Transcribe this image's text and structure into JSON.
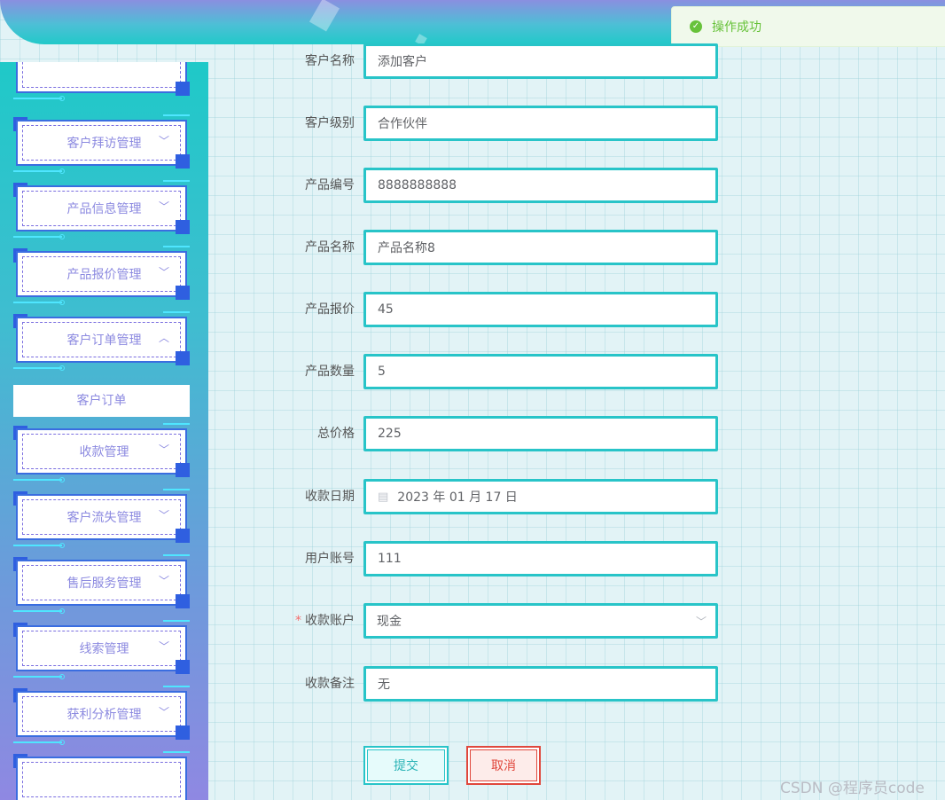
{
  "toast": {
    "message": "操作成功"
  },
  "sidebar": {
    "items": [
      {
        "label": "客户拜访管理",
        "expanded": false
      },
      {
        "label": "产品信息管理",
        "expanded": false
      },
      {
        "label": "产品报价管理",
        "expanded": false
      },
      {
        "label": "客户订单管理",
        "expanded": true
      },
      {
        "label": "收款管理",
        "expanded": false
      },
      {
        "label": "客户流失管理",
        "expanded": false
      },
      {
        "label": "售后服务管理",
        "expanded": false
      },
      {
        "label": "线索管理",
        "expanded": false
      },
      {
        "label": "获利分析管理",
        "expanded": false
      }
    ],
    "submenu": {
      "label": "客户订单"
    }
  },
  "form": {
    "fields": [
      {
        "label": "客户名称",
        "value": "添加客户"
      },
      {
        "label": "客户级别",
        "value": "合作伙伴"
      },
      {
        "label": "产品编号",
        "value": "8888888888"
      },
      {
        "label": "产品名称",
        "value": "产品名称8"
      },
      {
        "label": "产品报价",
        "value": "45"
      },
      {
        "label": "产品数量",
        "value": "5"
      },
      {
        "label": "总价格",
        "value": "225"
      },
      {
        "label": "收款日期",
        "value": "2023 年 01 月 17 日"
      },
      {
        "label": "用户账号",
        "value": "111"
      },
      {
        "label": "收款账户",
        "value": "现金",
        "required_mark": "*"
      },
      {
        "label": "收款备注",
        "value": "无"
      }
    ],
    "submit_label": "提交",
    "cancel_label": "取消"
  },
  "watermark": "CSDN @程序员code",
  "colors": {
    "accent": "#28c4c8",
    "menu_text": "#8c8ae0",
    "danger": "#e0473c",
    "success": "#67c23a"
  }
}
